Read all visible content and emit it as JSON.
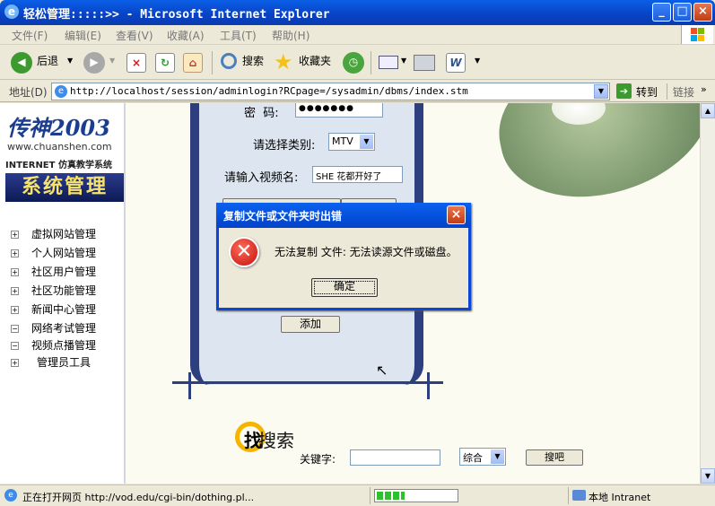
{
  "window": {
    "title": "轻松管理:::::>> - Microsoft Internet Explorer",
    "min": "_",
    "max": "□",
    "close": "×"
  },
  "menu": {
    "items": [
      "文件(F)",
      "编辑(E)",
      "查看(V)",
      "收藏(A)",
      "工具(T)",
      "帮助(H)"
    ]
  },
  "toolbar": {
    "back": "后退",
    "search": "搜索",
    "favorites": "收藏夹"
  },
  "address": {
    "label": "地址(D)",
    "url": "http://localhost/session/adminlogin?RCpage=/sysadmin/dbms/index.stm",
    "go": "转到",
    "links": "链接"
  },
  "sidebar": {
    "logo_brand": "传神2003",
    "logo_site": "www.chuanshen.com",
    "logo_sub": "INTERNET 仿真教学系统",
    "banner": "系统管理",
    "items": [
      {
        "label": "虚拟网站管理",
        "marker": "+"
      },
      {
        "label": "个人网站管理",
        "marker": "+"
      },
      {
        "label": "社区用户管理",
        "marker": "+"
      },
      {
        "label": "社区功能管理",
        "marker": "+"
      },
      {
        "label": "新闻中心管理",
        "marker": "+"
      },
      {
        "label": "网络考试管理",
        "marker": "−"
      },
      {
        "label": "视频点播管理",
        "marker": "−"
      },
      {
        "label": "管理员工具",
        "marker": "+"
      }
    ]
  },
  "form": {
    "password_label": "密  码:",
    "password_value": "●●●●●●●",
    "category_label": "请选择类别:",
    "category_value": "MTV",
    "video_label": "请输入视频名:",
    "video_value": "SHE 花都开好了",
    "add_button": "添加"
  },
  "search": {
    "title": "搜索",
    "title_glyph": "找",
    "keyword_label": "关键字:",
    "keyword_value": "",
    "type_value": "综合",
    "button": "搜吧"
  },
  "dialog": {
    "title": "复制文件或文件夹时出错",
    "message": "无法复制 文件: 无法读源文件或磁盘。",
    "ok": "确定",
    "close": "×"
  },
  "status": {
    "text": "正在打开网页 http://vod.edu/cgi-bin/dothing.pl...",
    "zone": "本地 Intranet",
    "progress": 0.35
  }
}
